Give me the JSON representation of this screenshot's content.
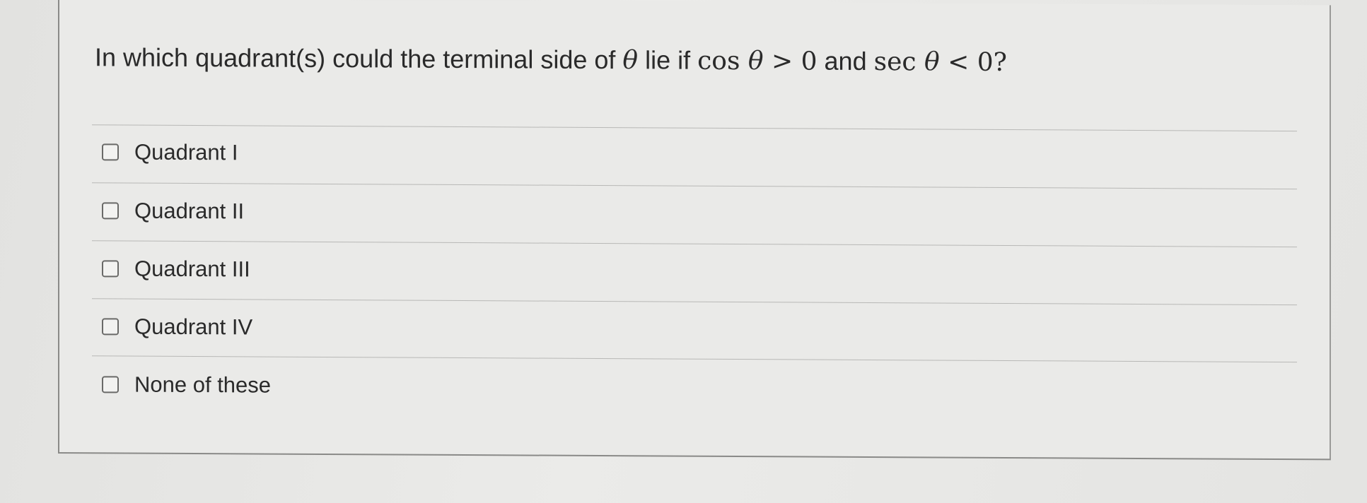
{
  "question": {
    "prefix": "In which quadrant(s) could the terminal side of ",
    "theta": "θ",
    "middle": " lie if ",
    "cond1": "cos",
    "gt": " > 0",
    "and": " and ",
    "cond2": "sec",
    "lt": " < 0?"
  },
  "options": [
    {
      "label": "Quadrant I",
      "checked": false
    },
    {
      "label": "Quadrant II",
      "checked": false
    },
    {
      "label": "Quadrant III",
      "checked": false
    },
    {
      "label": "Quadrant IV",
      "checked": false
    },
    {
      "label": "None of these",
      "checked": false
    }
  ]
}
